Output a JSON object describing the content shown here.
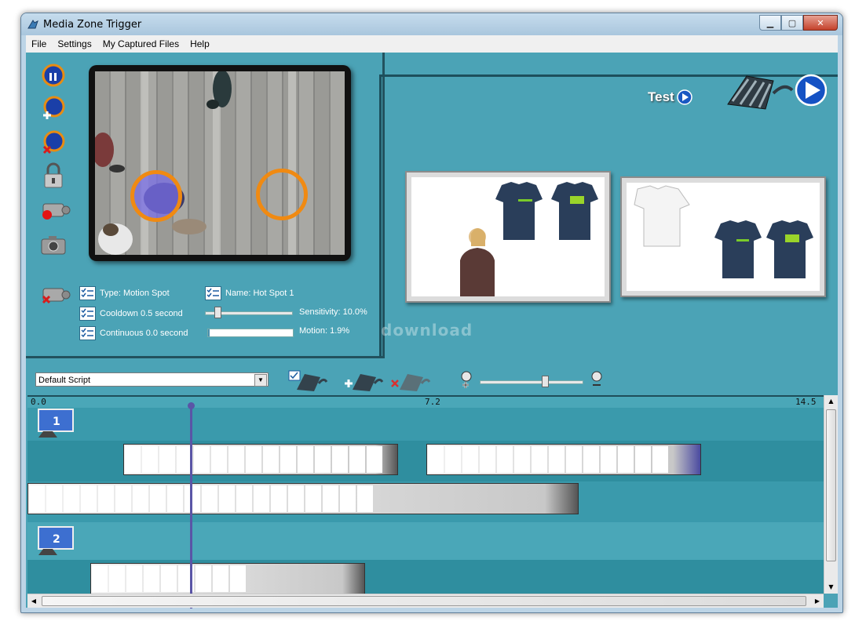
{
  "window": {
    "title": "Media Zone Trigger"
  },
  "menu": [
    "File",
    "Settings",
    "My Captured Files",
    "Help"
  ],
  "zone": {
    "type": "Type: Motion Spot",
    "name": "Name: Hot Spot 1",
    "cooldown": "Cooldown 0.5 second",
    "continuous": "Continuous 0.0 second",
    "sensitivity_label": "Sensitivity: 10.0%",
    "sensitivity_value": 0.1,
    "motion_label": "Motion: 1.9%",
    "motion_value": 0.019
  },
  "test_label": "Test",
  "watermark": "download",
  "script_select": {
    "value": "Default Script"
  },
  "ruler": {
    "start": "0.0",
    "mid": "7.2",
    "end": "14.5"
  },
  "tracks": [
    {
      "label": "1"
    },
    {
      "label": "2"
    }
  ],
  "colors": {
    "panel_bg": "#4ba3b6",
    "timeline_bg": "#3a9aac",
    "hotspot": "#f08a12",
    "accent_dark": "#1d4f5c"
  },
  "icons": [
    "pause-record-icon",
    "add-zone-icon",
    "remove-zone-icon",
    "lock-icon",
    "record-camera-icon",
    "snapshot-camera-icon",
    "delete-camera-icon",
    "test-play-icon",
    "film-play-icon",
    "add-film-icon",
    "remove-film-icon",
    "edit-film-icon",
    "zoom-in-icon",
    "zoom-out-icon"
  ]
}
